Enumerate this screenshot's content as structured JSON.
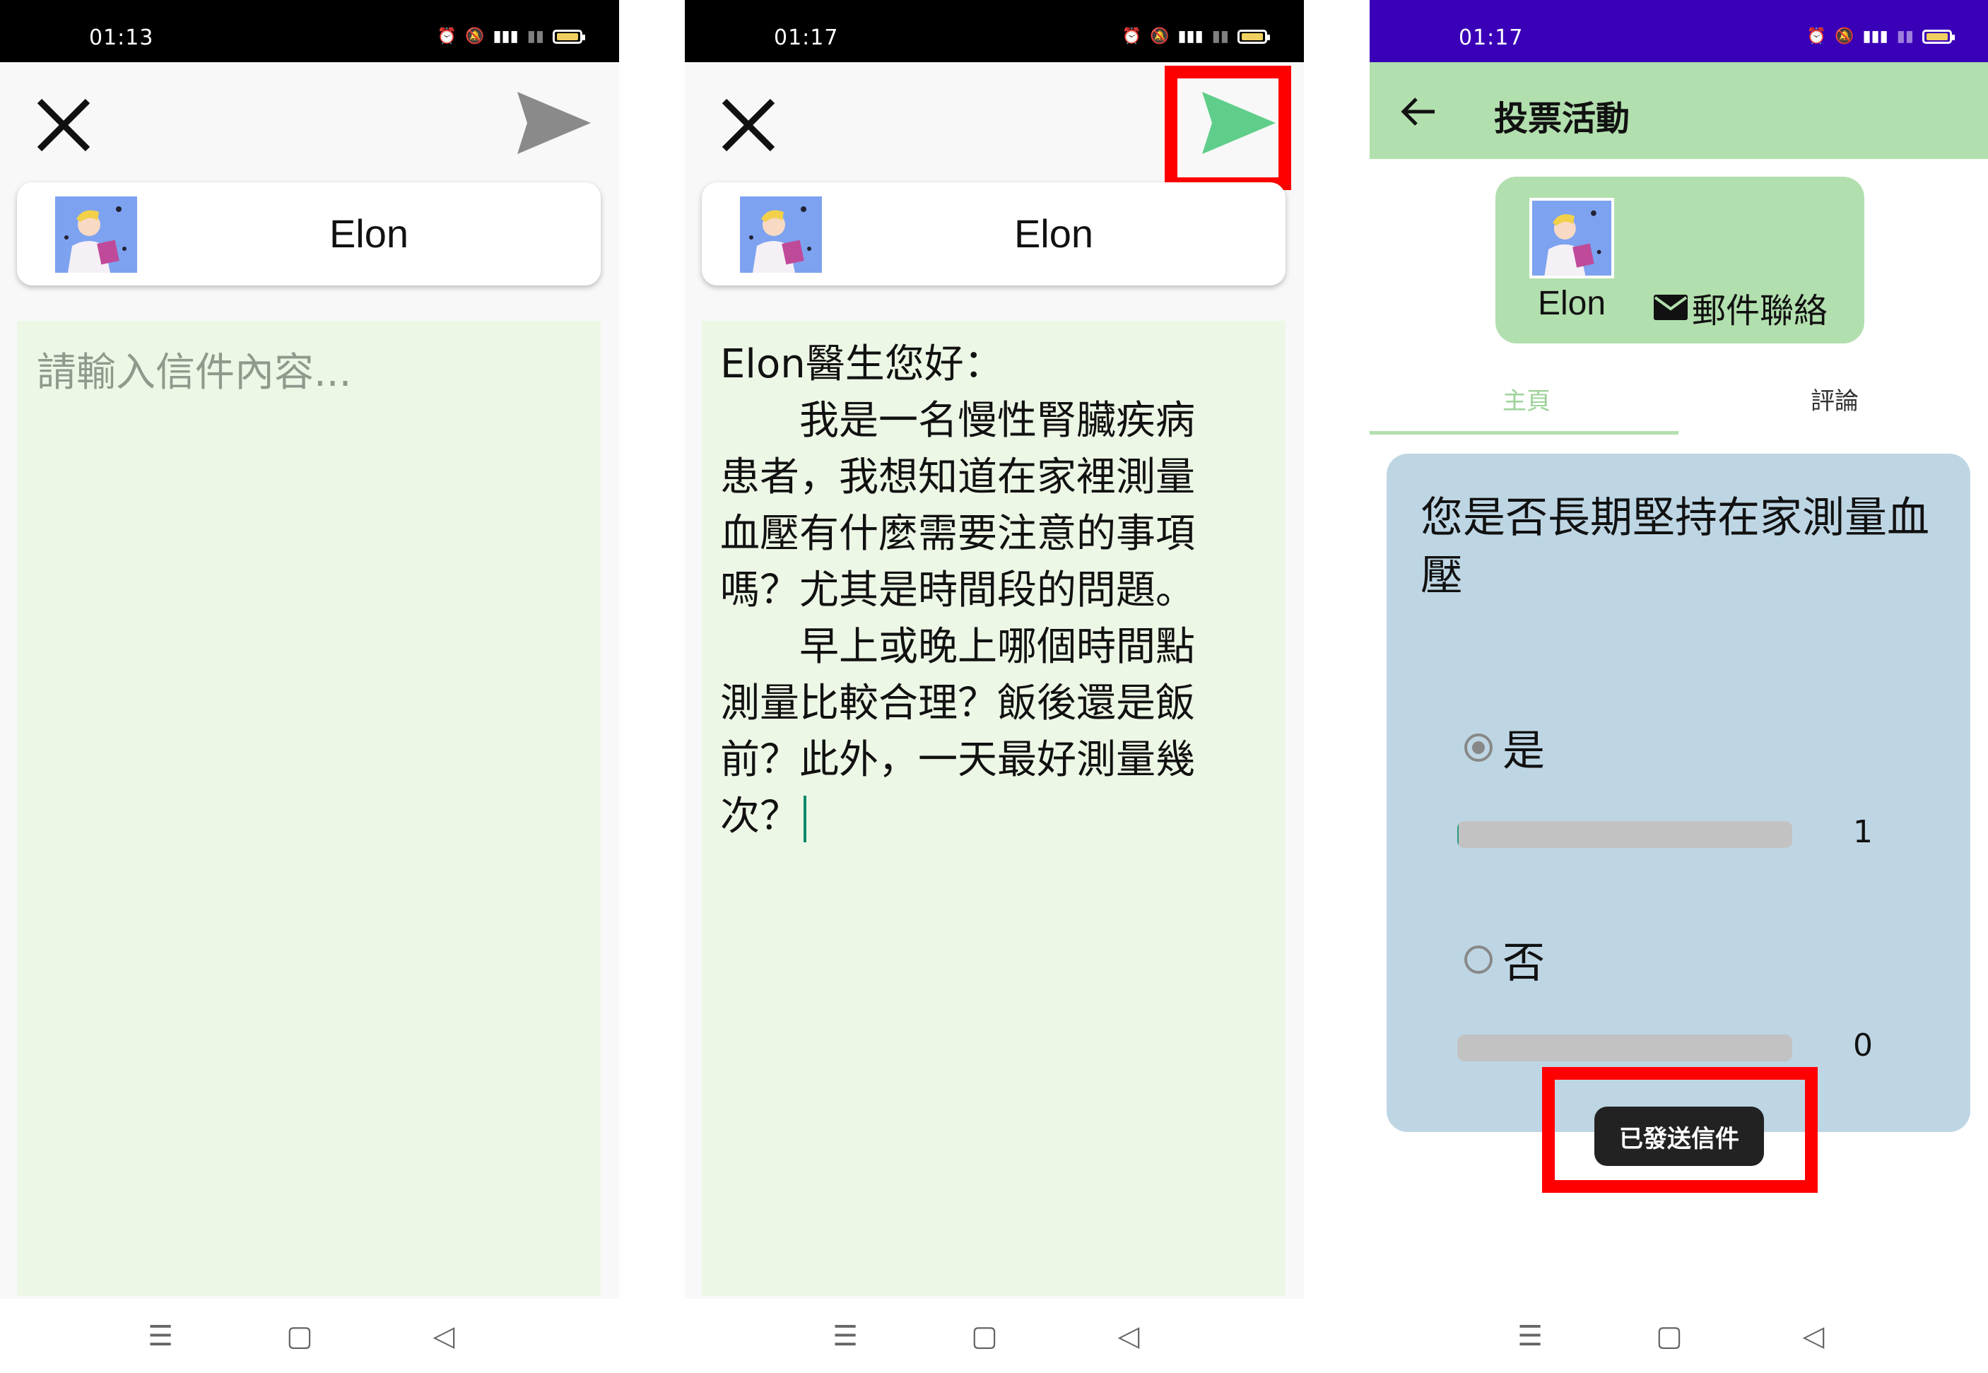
{
  "status_bar": {
    "screen1_time": "01:13",
    "screen2_time": "01:17",
    "screen3_time": "01:17",
    "icons": [
      "alarm-icon",
      "mute-icon",
      "signal-4g-icon",
      "signal-x-icon",
      "battery-icon"
    ]
  },
  "compose": {
    "recipient_name": "Elon",
    "placeholder": "請輸入信件內容...",
    "letter_lines": [
      "Elon醫生您好：",
      "　　我是一名慢性腎臟疾病",
      "患者，我想知道在家裡測量",
      "血壓有什麼需要注意的事項",
      "嗎？尤其是時間段的問題。",
      "　　早上或晚上哪個時間點",
      "測量比較合理？飯後還是飯",
      "前？此外，一天最好測量幾",
      "次？"
    ],
    "send_idle_color": "#8a8a8a",
    "send_active_color": "#5fce8a"
  },
  "poll_page": {
    "title": "投票活動",
    "doctor_name": "Elon",
    "mail_contact_label": "郵件聯絡",
    "tabs": {
      "home": "主頁",
      "comments": "評論"
    },
    "question": "您是否長期堅持在家測量血壓",
    "options": [
      {
        "label": "是",
        "count": "1",
        "fraction": 0.005,
        "selected": true
      },
      {
        "label": "否",
        "count": "0",
        "fraction": 0,
        "selected": false
      }
    ],
    "toast": "已發送信件"
  },
  "colors": {
    "accent_green": "#b2dfae",
    "editor_bg": "#edf7e6",
    "poll_card_bg": "#bed6e4",
    "highlight_red": "#ff0000",
    "status_purple": "#3a00b8"
  }
}
